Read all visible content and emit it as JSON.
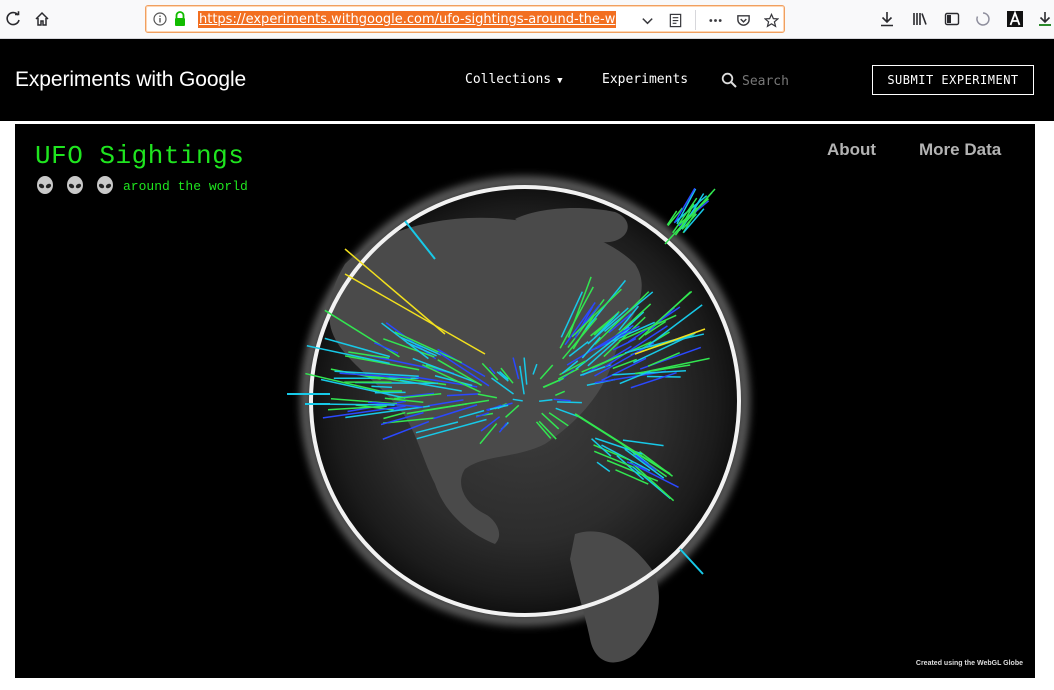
{
  "browser": {
    "url": "https://experiments.withgoogle.com/ufo-sightings-around-the-w",
    "icons": [
      "reload-icon",
      "home-icon",
      "info-icon",
      "lock-icon",
      "chevron-down-icon",
      "reader-icon",
      "more-icon",
      "pocket-icon",
      "star-icon",
      "download-icon",
      "library-icon",
      "sidebar-icon",
      "spinner-icon",
      "accessibility-icon",
      "download-progress-icon"
    ]
  },
  "site": {
    "title": "Experiments with Google",
    "nav": {
      "collections": "Collections",
      "experiments": "Experiments"
    },
    "search_placeholder": "Search",
    "submit_label": "SUBMIT EXPERIMENT"
  },
  "experiment": {
    "title": "UFO Sightings",
    "subtitle": "around the world",
    "links": {
      "about": "About",
      "more_data": "More Data"
    },
    "credit": "Created using the WebGL Globe",
    "colors": {
      "title": "#1fe51f",
      "spike_green": "#32e650",
      "spike_cyan": "#17c9e8",
      "spike_blue": "#2a48ff",
      "spike_yellow": "#f2e01e",
      "atmosphere": "#ffffff"
    }
  }
}
